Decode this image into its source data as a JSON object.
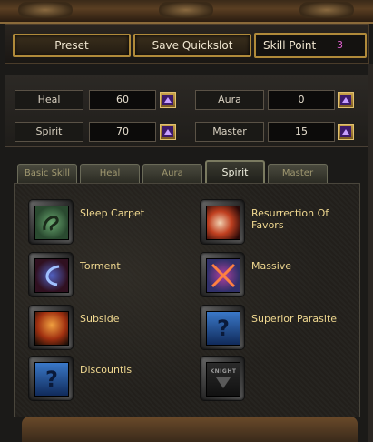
{
  "actions": {
    "preset_label": "Preset",
    "save_label": "Save Quickslot",
    "skill_point_label": "Skill Point",
    "skill_point_value": "3"
  },
  "stats": [
    {
      "label": "Heal",
      "value": "60"
    },
    {
      "label": "Aura",
      "value": "0"
    },
    {
      "label": "Spirit",
      "value": "70"
    },
    {
      "label": "Master",
      "value": "15"
    }
  ],
  "tabs": [
    {
      "label": "Basic Skill",
      "active": false
    },
    {
      "label": "Heal",
      "active": false
    },
    {
      "label": "Aura",
      "active": false
    },
    {
      "label": "Spirit",
      "active": true
    },
    {
      "label": "Master",
      "active": false
    }
  ],
  "skills": [
    {
      "name": "Sleep Carpet",
      "icon": "sleep-carpet-icon"
    },
    {
      "name": "Resurrection Of Favors",
      "icon": "resurrection-icon"
    },
    {
      "name": "Torment",
      "icon": "torment-icon"
    },
    {
      "name": "Massive",
      "icon": "massive-icon"
    },
    {
      "name": "Subside",
      "icon": "subside-icon"
    },
    {
      "name": "Superior Parasite",
      "icon": "question-mark-icon"
    },
    {
      "name": "Discountis",
      "icon": "question-mark-icon"
    },
    {
      "name": "",
      "icon": "knight-locked-icon",
      "badge": "KNIGHT"
    }
  ],
  "colors": {
    "gold_border": "#b08a3a",
    "skill_name": "#f0d890",
    "skill_point_value": "#e060d0"
  }
}
